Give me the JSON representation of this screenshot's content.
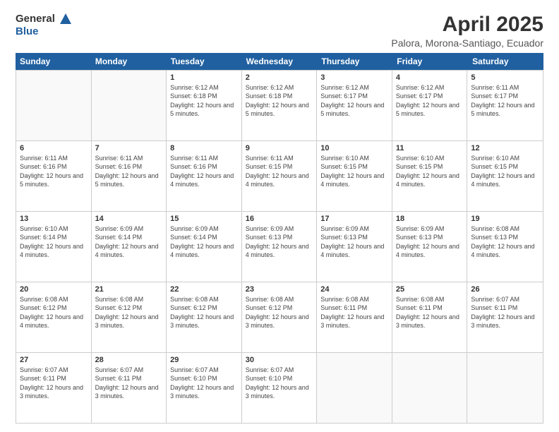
{
  "header": {
    "logo_general": "General",
    "logo_blue": "Blue",
    "title": "April 2025",
    "subtitle": "Palora, Morona-Santiago, Ecuador"
  },
  "calendar": {
    "days_of_week": [
      "Sunday",
      "Monday",
      "Tuesday",
      "Wednesday",
      "Thursday",
      "Friday",
      "Saturday"
    ],
    "rows": [
      [
        {
          "day": "",
          "info": ""
        },
        {
          "day": "",
          "info": ""
        },
        {
          "day": "1",
          "info": "Sunrise: 6:12 AM\nSunset: 6:18 PM\nDaylight: 12 hours and 5 minutes."
        },
        {
          "day": "2",
          "info": "Sunrise: 6:12 AM\nSunset: 6:18 PM\nDaylight: 12 hours and 5 minutes."
        },
        {
          "day": "3",
          "info": "Sunrise: 6:12 AM\nSunset: 6:17 PM\nDaylight: 12 hours and 5 minutes."
        },
        {
          "day": "4",
          "info": "Sunrise: 6:12 AM\nSunset: 6:17 PM\nDaylight: 12 hours and 5 minutes."
        },
        {
          "day": "5",
          "info": "Sunrise: 6:11 AM\nSunset: 6:17 PM\nDaylight: 12 hours and 5 minutes."
        }
      ],
      [
        {
          "day": "6",
          "info": "Sunrise: 6:11 AM\nSunset: 6:16 PM\nDaylight: 12 hours and 5 minutes."
        },
        {
          "day": "7",
          "info": "Sunrise: 6:11 AM\nSunset: 6:16 PM\nDaylight: 12 hours and 5 minutes."
        },
        {
          "day": "8",
          "info": "Sunrise: 6:11 AM\nSunset: 6:16 PM\nDaylight: 12 hours and 4 minutes."
        },
        {
          "day": "9",
          "info": "Sunrise: 6:11 AM\nSunset: 6:15 PM\nDaylight: 12 hours and 4 minutes."
        },
        {
          "day": "10",
          "info": "Sunrise: 6:10 AM\nSunset: 6:15 PM\nDaylight: 12 hours and 4 minutes."
        },
        {
          "day": "11",
          "info": "Sunrise: 6:10 AM\nSunset: 6:15 PM\nDaylight: 12 hours and 4 minutes."
        },
        {
          "day": "12",
          "info": "Sunrise: 6:10 AM\nSunset: 6:15 PM\nDaylight: 12 hours and 4 minutes."
        }
      ],
      [
        {
          "day": "13",
          "info": "Sunrise: 6:10 AM\nSunset: 6:14 PM\nDaylight: 12 hours and 4 minutes."
        },
        {
          "day": "14",
          "info": "Sunrise: 6:09 AM\nSunset: 6:14 PM\nDaylight: 12 hours and 4 minutes."
        },
        {
          "day": "15",
          "info": "Sunrise: 6:09 AM\nSunset: 6:14 PM\nDaylight: 12 hours and 4 minutes."
        },
        {
          "day": "16",
          "info": "Sunrise: 6:09 AM\nSunset: 6:13 PM\nDaylight: 12 hours and 4 minutes."
        },
        {
          "day": "17",
          "info": "Sunrise: 6:09 AM\nSunset: 6:13 PM\nDaylight: 12 hours and 4 minutes."
        },
        {
          "day": "18",
          "info": "Sunrise: 6:09 AM\nSunset: 6:13 PM\nDaylight: 12 hours and 4 minutes."
        },
        {
          "day": "19",
          "info": "Sunrise: 6:08 AM\nSunset: 6:13 PM\nDaylight: 12 hours and 4 minutes."
        }
      ],
      [
        {
          "day": "20",
          "info": "Sunrise: 6:08 AM\nSunset: 6:12 PM\nDaylight: 12 hours and 4 minutes."
        },
        {
          "day": "21",
          "info": "Sunrise: 6:08 AM\nSunset: 6:12 PM\nDaylight: 12 hours and 3 minutes."
        },
        {
          "day": "22",
          "info": "Sunrise: 6:08 AM\nSunset: 6:12 PM\nDaylight: 12 hours and 3 minutes."
        },
        {
          "day": "23",
          "info": "Sunrise: 6:08 AM\nSunset: 6:12 PM\nDaylight: 12 hours and 3 minutes."
        },
        {
          "day": "24",
          "info": "Sunrise: 6:08 AM\nSunset: 6:11 PM\nDaylight: 12 hours and 3 minutes."
        },
        {
          "day": "25",
          "info": "Sunrise: 6:08 AM\nSunset: 6:11 PM\nDaylight: 12 hours and 3 minutes."
        },
        {
          "day": "26",
          "info": "Sunrise: 6:07 AM\nSunset: 6:11 PM\nDaylight: 12 hours and 3 minutes."
        }
      ],
      [
        {
          "day": "27",
          "info": "Sunrise: 6:07 AM\nSunset: 6:11 PM\nDaylight: 12 hours and 3 minutes."
        },
        {
          "day": "28",
          "info": "Sunrise: 6:07 AM\nSunset: 6:11 PM\nDaylight: 12 hours and 3 minutes."
        },
        {
          "day": "29",
          "info": "Sunrise: 6:07 AM\nSunset: 6:10 PM\nDaylight: 12 hours and 3 minutes."
        },
        {
          "day": "30",
          "info": "Sunrise: 6:07 AM\nSunset: 6:10 PM\nDaylight: 12 hours and 3 minutes."
        },
        {
          "day": "",
          "info": ""
        },
        {
          "day": "",
          "info": ""
        },
        {
          "day": "",
          "info": ""
        }
      ]
    ]
  }
}
